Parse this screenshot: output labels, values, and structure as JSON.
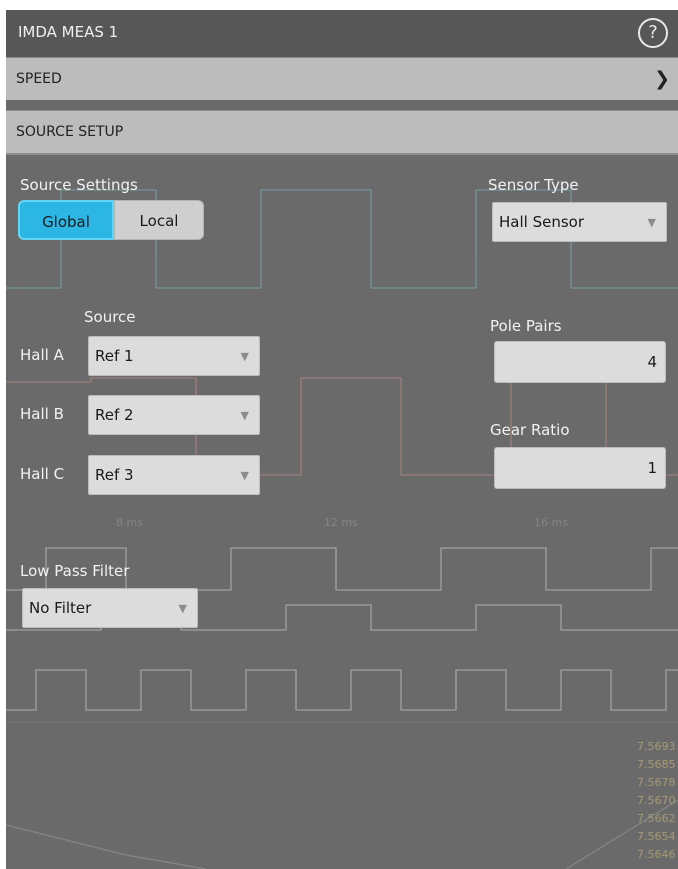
{
  "window": {
    "title": "IMDA MEAS 1",
    "help_icon": "help-circle-icon",
    "help_glyph": "?"
  },
  "sections": {
    "speed": {
      "label": "SPEED",
      "chevron": "chevron-right-icon",
      "chevron_glyph": "❯"
    },
    "source_setup": {
      "label": "SOURCE SETUP"
    }
  },
  "source_settings": {
    "label": "Source Settings",
    "options": [
      "Global",
      "Local"
    ],
    "selected": "Global"
  },
  "sensor_type": {
    "label": "Sensor Type",
    "value": "Hall Sensor"
  },
  "source": {
    "header": "Source",
    "rows": [
      {
        "label": "Hall A",
        "value": "Ref 1"
      },
      {
        "label": "Hall B",
        "value": "Ref 2"
      },
      {
        "label": "Hall C",
        "value": "Ref 3"
      }
    ]
  },
  "pole_pairs": {
    "label": "Pole Pairs",
    "value": "4"
  },
  "gear_ratio": {
    "label": "Gear Ratio",
    "value": "1"
  },
  "low_pass_filter": {
    "label": "Low Pass Filter",
    "value": "No Filter"
  },
  "dropdown_arrow_glyph": "▼",
  "background_scope": {
    "time_labels": [
      "8 ms",
      "12 ms",
      "16 ms"
    ],
    "readouts": [
      "7.5693",
      "7.5685",
      "7.5678",
      "7.5670",
      "7.5662",
      "7.5654",
      "7.5646"
    ],
    "colors": {
      "trace_cyan": "#7fb6c2",
      "trace_red": "#c88a8a",
      "trace_white": "#cfcfcf",
      "readout": "#b8a97a"
    }
  },
  "colors": {
    "accent": "#2cb6e4",
    "panel": "#6a6a6a",
    "titlebar": "#575757",
    "header_bar": "#c3c3c3"
  }
}
